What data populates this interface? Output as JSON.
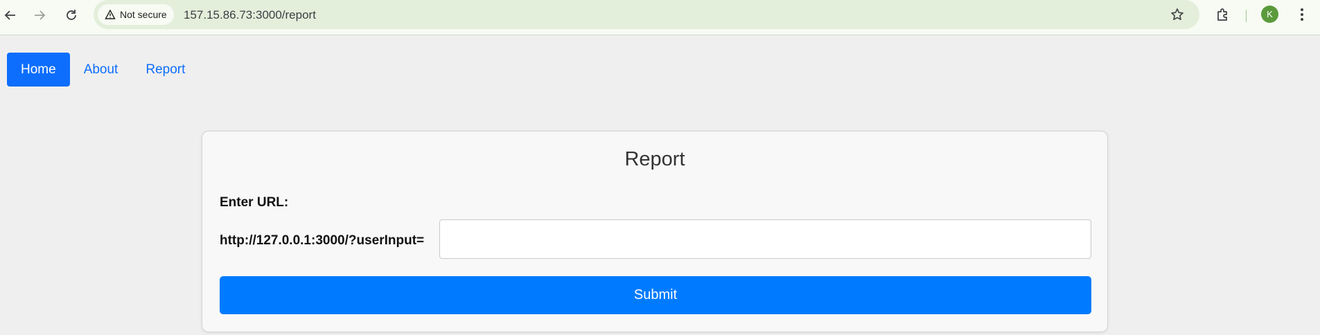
{
  "browser": {
    "security_chip": "Not secure",
    "url": "157.15.86.73:3000/report",
    "profile_initial": "K"
  },
  "nav": {
    "items": [
      {
        "label": "Home",
        "active": true
      },
      {
        "label": "About",
        "active": false
      },
      {
        "label": "Report",
        "active": false
      }
    ]
  },
  "form": {
    "title": "Report",
    "label": "Enter URL:",
    "prefix": "http://127.0.0.1:3000/?userInput=",
    "input_value": "",
    "submit_label": "Submit"
  },
  "colors": {
    "primary": "#0d6efd",
    "submit": "#007bff",
    "page_bg": "#efefef"
  }
}
